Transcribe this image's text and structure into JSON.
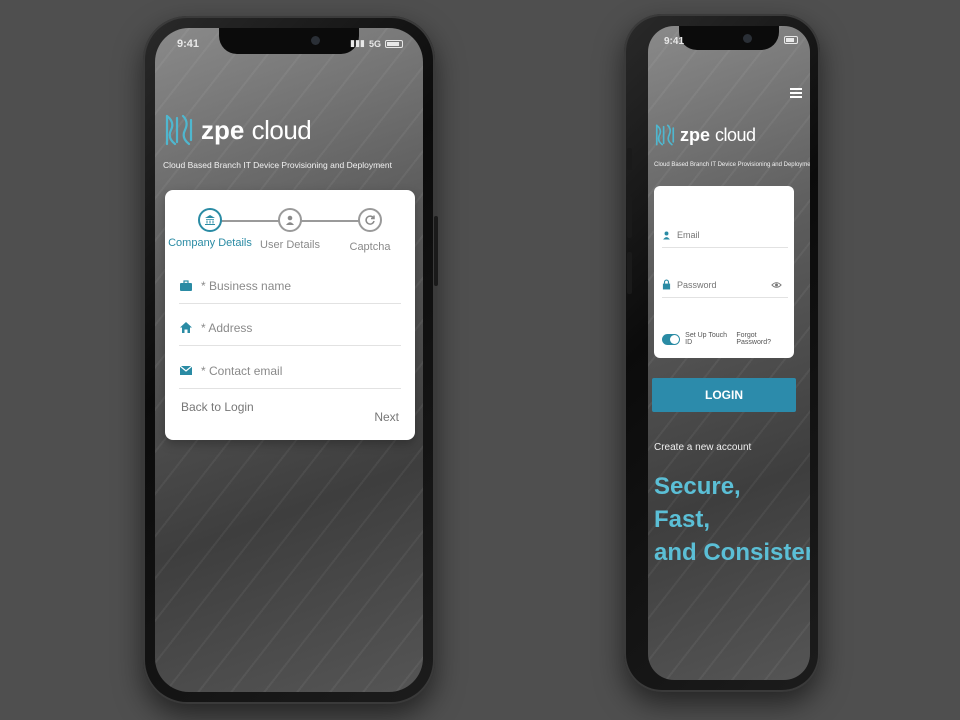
{
  "status_bar": {
    "time": "9:41",
    "network": "5G"
  },
  "brand": {
    "logo_primary": "zpe",
    "logo_secondary": "cloud",
    "tagline": "Cloud Based Branch IT Device Provisioning and Deployment",
    "accent_color": "#2a8ba4",
    "slogan_color": "#5bbfd6"
  },
  "signup": {
    "steps": [
      {
        "label": "Company Details",
        "icon": "bank-icon",
        "active": true
      },
      {
        "label": "User Details",
        "icon": "user-icon",
        "active": false
      },
      {
        "label": "Captcha",
        "icon": "refresh-icon",
        "active": false
      }
    ],
    "fields": [
      {
        "placeholder": "* Business name",
        "icon": "briefcase-icon"
      },
      {
        "placeholder": "* Address",
        "icon": "home-icon"
      },
      {
        "placeholder": "* Contact email",
        "icon": "envelope-icon"
      }
    ],
    "back_label": "Back to Login",
    "next_label": "Next"
  },
  "login": {
    "email_placeholder": "Email",
    "password_placeholder": "Password",
    "touch_id_label": "Set Up Touch ID",
    "forgot_label": "Forgot Password?",
    "login_label": "LOGIN",
    "create_account_label": "Create a new account",
    "slogan": [
      "Secure,",
      "Fast,",
      "and Consistent."
    ]
  }
}
